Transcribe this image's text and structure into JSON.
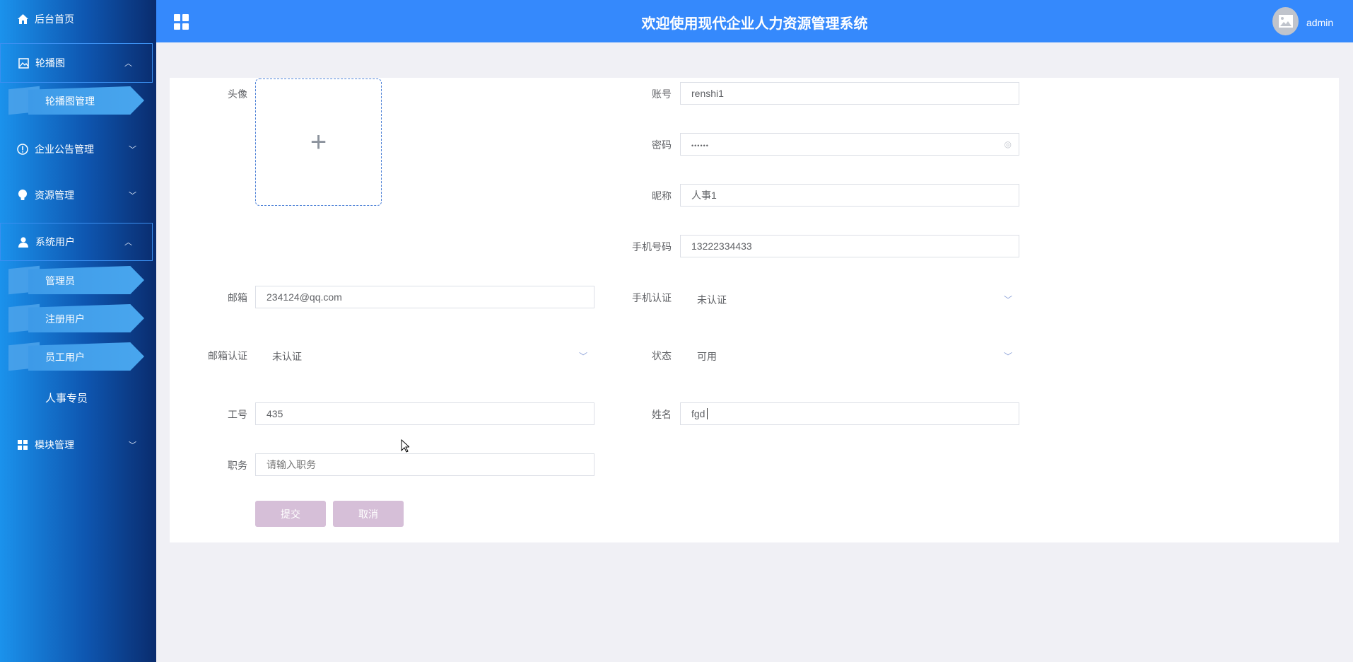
{
  "header": {
    "title": "欢迎使用现代企业人力资源管理系统",
    "user": "admin"
  },
  "sidebar": {
    "home": "后台首页",
    "carousel": "轮播图",
    "carousel_manage": "轮播图管理",
    "notice": "企业公告管理",
    "resource": "资源管理",
    "sysuser": "系统用户",
    "admin": "管理员",
    "registered": "注册用户",
    "employee": "员工用户",
    "hr": "人事专员",
    "module": "模块管理"
  },
  "form": {
    "avatar_label": "头像",
    "account_label": "账号",
    "account": "renshi1",
    "password_label": "密码",
    "password": "••••••",
    "nickname_label": "昵称",
    "nickname": "人事1",
    "phone_label": "手机号码",
    "phone": "13222334433",
    "email_label": "邮箱",
    "email": "234124@qq.com",
    "phone_verify_label": "手机认证",
    "phone_verify": "未认证",
    "email_verify_label": "邮箱认证",
    "email_verify": "未认证",
    "status_label": "状态",
    "status": "可用",
    "jobno_label": "工号",
    "jobno": "435",
    "name_label": "姓名",
    "name": "fgd",
    "position_label": "职务",
    "position_placeholder": "请输入职务",
    "submit": "提交",
    "cancel": "取消"
  }
}
